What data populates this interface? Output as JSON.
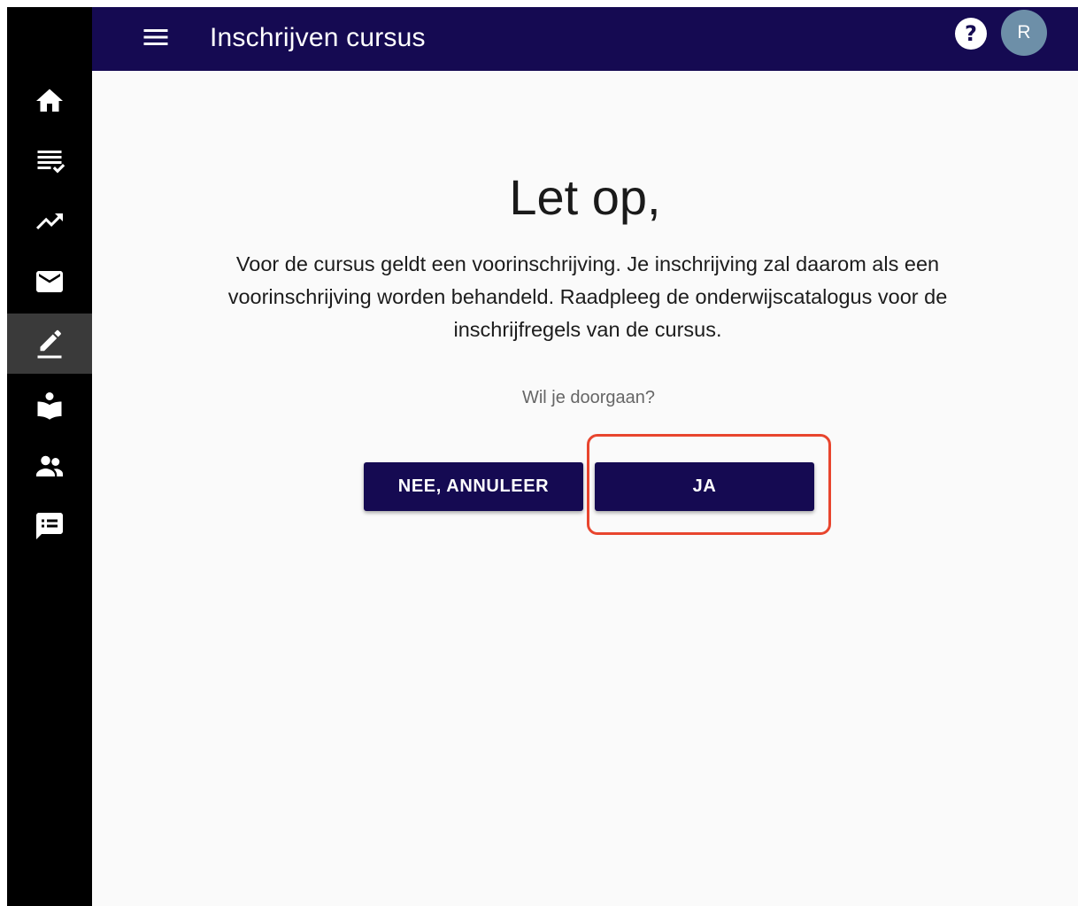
{
  "header": {
    "title": "Inschrijven cursus",
    "menu_icon": "menu-icon",
    "help_icon": "help-icon",
    "help_glyph": "?",
    "avatar_initial": "R",
    "bar_color": "#150a52",
    "avatar_color": "#6d8fa8"
  },
  "sidebar": {
    "items": [
      {
        "icon": "home-icon",
        "active": false
      },
      {
        "icon": "list-check-icon",
        "active": false
      },
      {
        "icon": "trending-up-icon",
        "active": false
      },
      {
        "icon": "mail-icon",
        "active": false
      },
      {
        "icon": "edit-icon",
        "active": true
      },
      {
        "icon": "reading-person-icon",
        "active": false
      },
      {
        "icon": "people-icon",
        "active": false
      },
      {
        "icon": "feedback-icon",
        "active": false
      }
    ]
  },
  "dialog": {
    "heading": "Let op,",
    "message": "Voor de cursus geldt een voorinschrijving. Je inschrijving zal daarom als een voorinschrijving worden behandeld. Raadpleeg de onderwijscatalogus voor de inschrijfregels van de cursus.",
    "question": "Wil je doorgaan?",
    "cancel_label": "NEE, ANNULEER",
    "confirm_label": "JA",
    "highlight_color": "#e8452e"
  }
}
